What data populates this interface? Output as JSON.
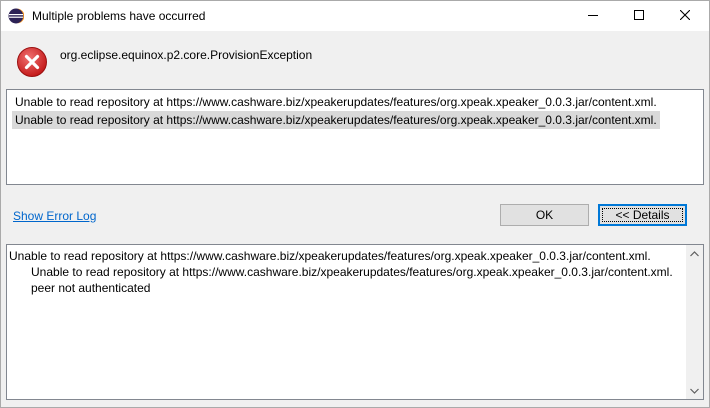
{
  "window": {
    "title": "Multiple problems have occurred"
  },
  "header": {
    "exception": "org.eclipse.equinox.p2.core.ProvisionException"
  },
  "messages": [
    "Unable to read repository at https://www.cashware.biz/xpeakerupdates/features/org.xpeak.xpeaker_0.0.3.jar/content.xml.",
    "Unable to read repository at https://www.cashware.biz/xpeakerupdates/features/org.xpeak.xpeaker_0.0.3.jar/content.xml."
  ],
  "actions": {
    "error_log_link": "Show Error Log",
    "ok_label": "OK",
    "details_label": "<< Details"
  },
  "details": [
    "Unable to read repository at https://www.cashware.biz/xpeakerupdates/features/org.xpeak.xpeaker_0.0.3.jar/content.xml.",
    "Unable to read repository at https://www.cashware.biz/xpeakerupdates/features/org.xpeak.xpeaker_0.0.3.jar/content.xml.",
    "peer not authenticated"
  ],
  "colors": {
    "link": "#0066cc",
    "error_red": "#d03030",
    "selection": "#d9d9d9",
    "focus_border": "#0078d7"
  },
  "icons": {
    "app": "eclipse-icon",
    "error": "error-icon",
    "minimize": "minimize-icon",
    "maximize": "maximize-icon",
    "close": "close-icon"
  }
}
